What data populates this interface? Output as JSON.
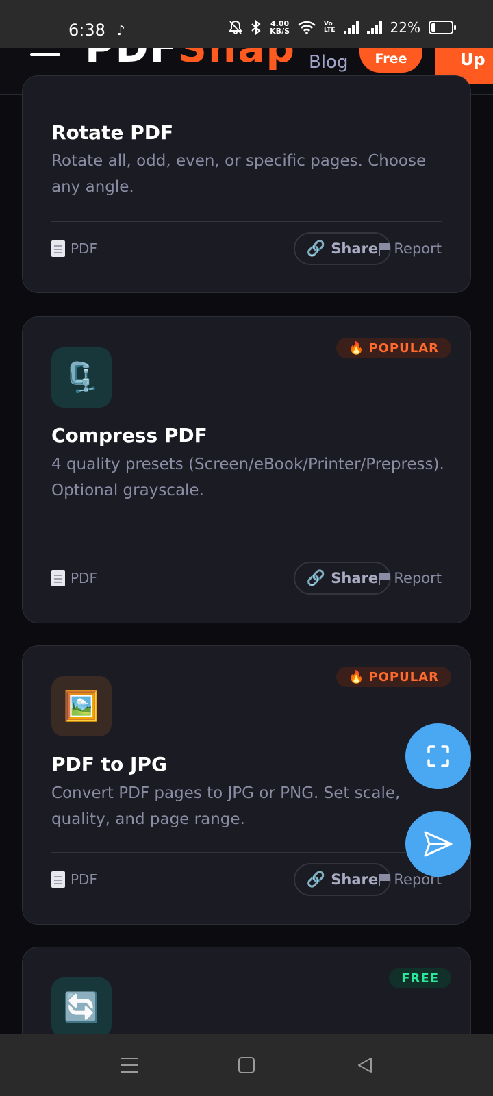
{
  "status_bar": {
    "time": "6:38",
    "net_speed_value": "4.00",
    "net_speed_unit": "KB/S",
    "volte_top": "Vo",
    "volte_bottom": "LTE",
    "battery_percent": "22%",
    "battery_level": 0.22,
    "icons": [
      "tiktok-icon",
      "bell-muted-icon",
      "bluetooth-icon",
      "wifi-icon",
      "signal-icon",
      "signal-icon",
      "battery-icon"
    ]
  },
  "header": {
    "logo_pdf": "PDF",
    "logo_snap": "Snap",
    "blog_label": "Blog",
    "free_label": "Free",
    "signup_label": "Up"
  },
  "cards": [
    {
      "title": "Rotate PDF",
      "description": "Rotate all, odd, even, or specific pages. Choose any angle.",
      "file_type": "PDF",
      "share_label": "Share",
      "report_label": "Report"
    },
    {
      "title": "Compress PDF",
      "description": "4 quality presets (Screen/eBook/Printer/Prepress). Optional grayscale.",
      "file_type": "PDF",
      "share_label": "Share",
      "report_label": "Report",
      "badge": "POPULAR",
      "badge_emoji": "🔥",
      "icon_emoji": "🗜️",
      "icon_bg": "#17373a"
    },
    {
      "title": "PDF to JPG",
      "description": "Convert PDF pages to JPG or PNG. Set scale, quality, and page range.",
      "file_type": "PDF",
      "share_label": "Share",
      "report_label": "Report",
      "badge": "POPULAR",
      "badge_emoji": "🔥",
      "icon_emoji": "🖼️",
      "icon_bg": "#3a2a24"
    },
    {
      "badge": "FREE",
      "icon_emoji": "🔄",
      "icon_bg": "#17373a"
    }
  ],
  "fabs": {
    "scan_icon": "scan-frame-icon",
    "send_icon": "send-icon",
    "color": "#4aa8f2"
  },
  "colors": {
    "brand_orange": "#ff5a1f",
    "card_bg": "#1b1b24",
    "page_bg": "#0b0b10",
    "muted_text": "#8a8ca3"
  }
}
